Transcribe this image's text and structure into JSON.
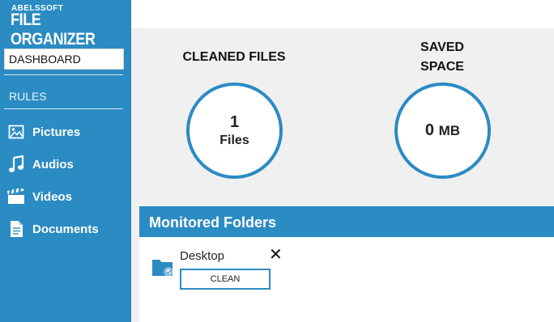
{
  "brand": {
    "vendor": "ABELSSOFT",
    "product": "FILE ORGANIZER"
  },
  "sidebar": {
    "dashboard_label": "DASHBOARD",
    "section_label": "RULES",
    "items": [
      {
        "label": "Pictures",
        "icon": "picture-icon"
      },
      {
        "label": "Audios",
        "icon": "music-note-icon"
      },
      {
        "label": "Videos",
        "icon": "clapperboard-icon"
      },
      {
        "label": "Documents",
        "icon": "document-icon"
      }
    ]
  },
  "stats": {
    "cleaned_title": "CLEANED FILES",
    "cleaned_value": "1",
    "cleaned_unit": "Files",
    "saved_title_line1": "SAVED",
    "saved_title_line2": "SPACE",
    "saved_value": "0",
    "saved_unit": "MB"
  },
  "monitored": {
    "header": "Monitored Folders",
    "folders": [
      {
        "name": "Desktop",
        "action_label": "CLEAN",
        "remove_symbol": "✕"
      }
    ]
  },
  "colors": {
    "accent": "#2b8bc3",
    "background": "#f0f0f0"
  }
}
